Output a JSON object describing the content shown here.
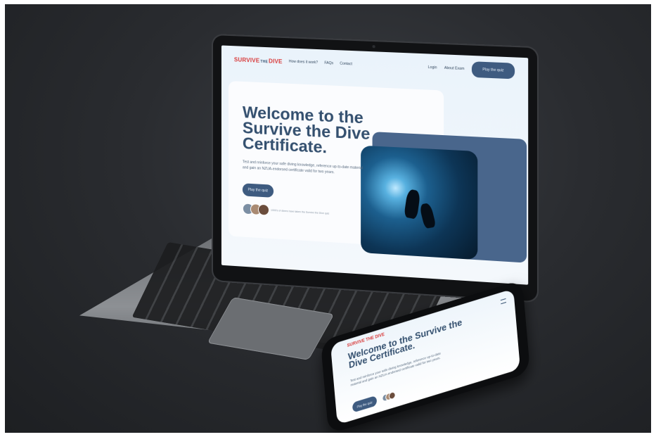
{
  "laptop": {
    "logo": {
      "word1": "SURVIVE",
      "word2": "THE",
      "word3": "DIVE"
    },
    "nav": {
      "links": [
        "How does it work?",
        "FAQs",
        "Contact"
      ],
      "login": "Login",
      "about": "About Exam",
      "cta": "Play the quiz"
    },
    "hero": {
      "title": "Welcome to the Survive the Dive Certificate.",
      "copy": "Test and reinforce your safe diving knowledge, reference up-to-date material and gain an NZUA-endorsed certificate valid for two years.",
      "cta": "Play the quiz",
      "social_proof": "1000's of divers have taken the Survive the Dive quiz"
    }
  },
  "phone": {
    "logo": "SURVIVE THE DIVE",
    "title": "Welcome to the Survive the Dive Certificate.",
    "copy": "Test and reinforce your safe diving knowledge, reference up-to-date material and gain an NZUA-endorsed certificate valid for two years.",
    "cta": "Play the quiz"
  },
  "colors": {
    "brand_red": "#d83a3a",
    "navy": "#34506f",
    "button": "#3e5b80",
    "background": "#2a2c30"
  }
}
